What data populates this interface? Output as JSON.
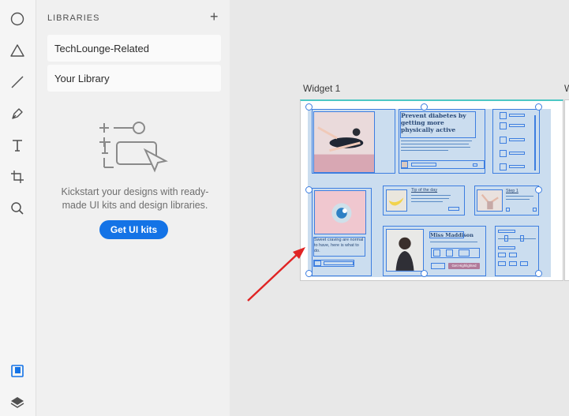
{
  "toolbar": {
    "tools": [
      "ellipse-icon",
      "triangle-icon",
      "line-icon",
      "pen-icon",
      "text-icon",
      "artboard-icon",
      "zoom-icon",
      "libraries-icon",
      "layers-icon"
    ]
  },
  "libraries": {
    "header": "LIBRARIES",
    "add_label": "+",
    "items": [
      {
        "label": "TechLounge-Related"
      },
      {
        "label": "Your Library"
      }
    ],
    "kit_text": "Kickstart your designs with ready-made UI kits and design libraries.",
    "kit_button": "Get UI kits"
  },
  "canvas": {
    "artboard_title": "Widget 1",
    "artboard2_title": "W",
    "widget": {
      "headline": "Prevent diabetes by getting more physically active",
      "card_title_1": "Tip of the day",
      "card_title_2": "Step 1",
      "craving_text": "Sweet craving are normal to have, here is what to do.",
      "profile_name": "Miss Maddison",
      "profile_button": "Get Highlighted"
    }
  },
  "colors": {
    "accent": "#1473e6",
    "selection": "#3d7ee0",
    "artboard_top": "#4dc7c4",
    "annotation_arrow": "#e02424"
  }
}
